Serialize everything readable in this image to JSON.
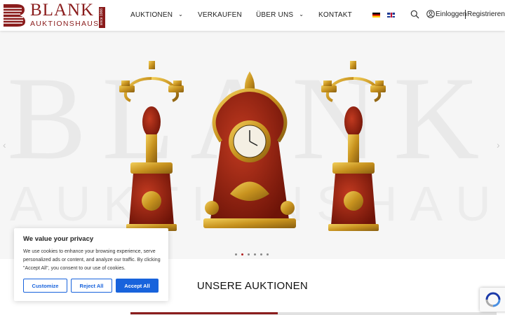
{
  "header": {
    "logo": {
      "word": "BLANK",
      "sub": "AUKTIONSHAUS",
      "badge": "since 1966"
    },
    "nav": [
      {
        "label": "AUKTIONEN",
        "has_dropdown": true
      },
      {
        "label": "VERKAUFEN",
        "has_dropdown": false
      },
      {
        "label": "ÜBER UNS",
        "has_dropdown": true
      },
      {
        "label": "KONTAKT",
        "has_dropdown": false
      }
    ],
    "languages": [
      "de-flag-icon",
      "en-flag-icon"
    ],
    "search_icon": "search-icon",
    "user_icon": "user-circle-icon",
    "login_label": "Einloggen",
    "register_label": "Registrieren"
  },
  "hero": {
    "watermark_main": "BLANK",
    "watermark_sub": "AUKTIONSHAUS",
    "slides_total": 6,
    "active_slide": 2,
    "colors": {
      "accent": "#b12020",
      "brand": "#8a1c1c"
    }
  },
  "section": {
    "title": "UNSERE AUKTIONEN"
  },
  "cookie": {
    "title": "We value your privacy",
    "body": "We use cookies to enhance your browsing experience, serve personalized ads or content, and analyze our traffic. By clicking \"Accept All\", you consent to our use of cookies.",
    "customize_label": "Customize",
    "reject_label": "Reject All",
    "accept_label": "Accept All",
    "button_color": "#1863dc"
  },
  "recaptcha": {
    "icon": "recaptcha-icon"
  }
}
